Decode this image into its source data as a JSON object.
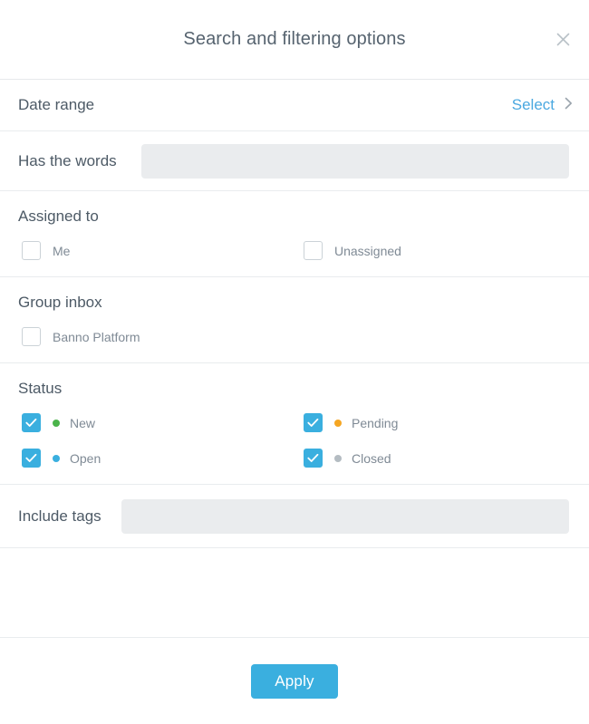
{
  "dialog": {
    "title": "Search and filtering options",
    "close_icon": "close-icon"
  },
  "date_range": {
    "label": "Date range",
    "select_label": "Select",
    "chevron_icon": "chevron-right-icon"
  },
  "has_words": {
    "label": "Has the words",
    "value": "",
    "placeholder": ""
  },
  "assigned_to": {
    "label": "Assigned to",
    "options": [
      {
        "label": "Me",
        "checked": false
      },
      {
        "label": "Unassigned",
        "checked": false
      }
    ]
  },
  "group_inbox": {
    "label": "Group inbox",
    "options": [
      {
        "label": "Banno Platform",
        "checked": false
      }
    ]
  },
  "status": {
    "label": "Status",
    "options": [
      {
        "label": "New",
        "checked": true,
        "dot_color": "#4bb44b"
      },
      {
        "label": "Pending",
        "checked": true,
        "dot_color": "#f5a623"
      },
      {
        "label": "Open",
        "checked": true,
        "dot_color": "#3aafdf"
      },
      {
        "label": "Closed",
        "checked": true,
        "dot_color": "#b4bcc2"
      }
    ]
  },
  "include_tags": {
    "label": "Include tags",
    "value": "",
    "placeholder": ""
  },
  "footer": {
    "apply_label": "Apply"
  },
  "colors": {
    "accent": "#3aafdf",
    "link": "#4aa8e0",
    "label": "#4d5a66",
    "muted_label": "#7f8a95",
    "input_bg": "#eaecee",
    "divider": "#e9ecee"
  }
}
